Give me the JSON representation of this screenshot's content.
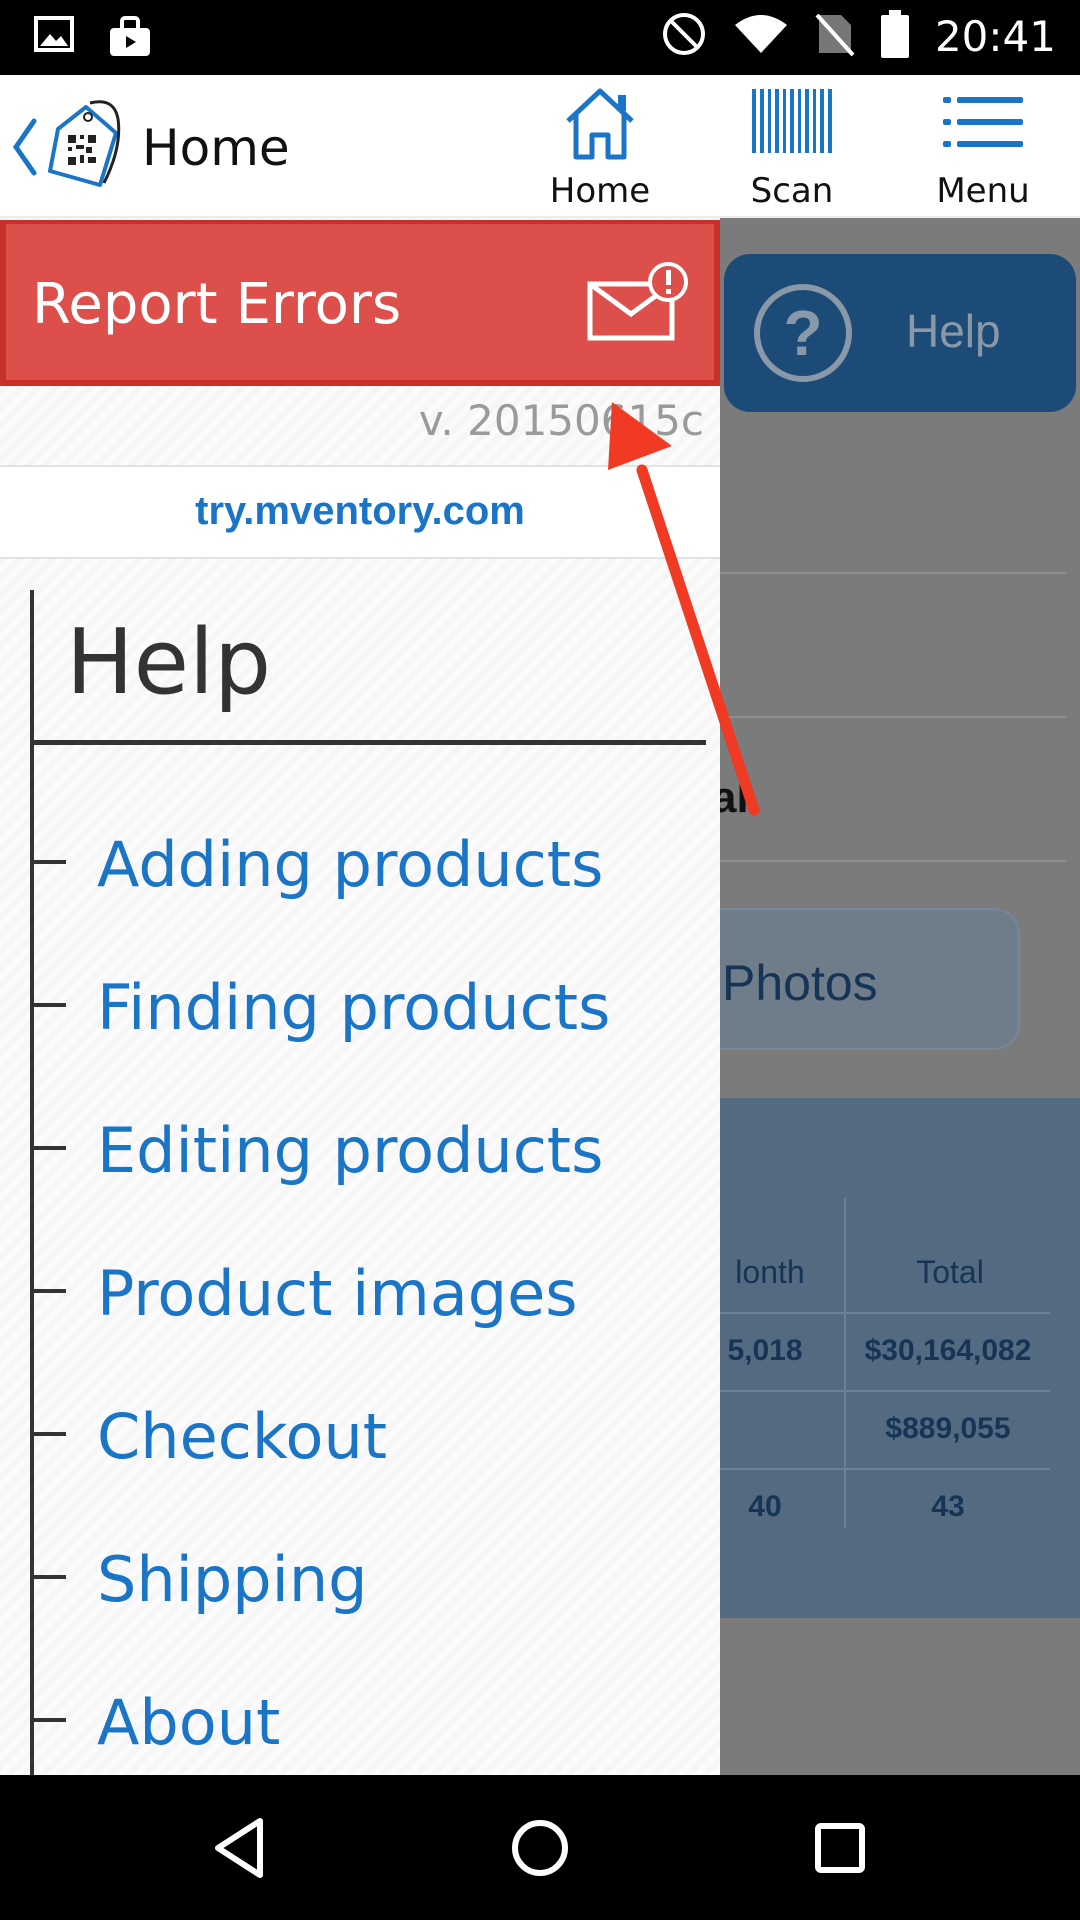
{
  "status_bar": {
    "time": "20:41",
    "left_icons": [
      "image-icon",
      "shopping-bag-icon"
    ],
    "right_icons": [
      "do-not-disturb-icon",
      "wifi-icon",
      "no-sim-icon",
      "battery-icon"
    ]
  },
  "app_bar": {
    "title": "Home",
    "nav": [
      {
        "label": "Home",
        "icon": "home-icon"
      },
      {
        "label": "Scan",
        "icon": "barcode-icon"
      },
      {
        "label": "Menu",
        "icon": "menu-icon"
      }
    ]
  },
  "drawer": {
    "report_label": "Report Errors",
    "version": "v. 20150615c",
    "site": "try.mventory.com",
    "help_title": "Help",
    "help_items": [
      "Adding products",
      "Finding products",
      "Editing products",
      "Product images",
      "Checkout",
      "Shipping",
      "About"
    ]
  },
  "background": {
    "help_button": "Help",
    "partial_text": "al",
    "photos_button": "Photos",
    "stats": {
      "headers": [
        "lonth",
        "Total"
      ],
      "rows": [
        [
          "5,018",
          "$30,164,082"
        ],
        [
          "",
          "$889,055"
        ],
        [
          "40",
          "43"
        ]
      ]
    }
  },
  "colors": {
    "report_red": "#dc4f4b",
    "link_blue": "#1b75c6",
    "help_button_bg": "#1c4b78",
    "arrow_red": "#f03a24"
  }
}
